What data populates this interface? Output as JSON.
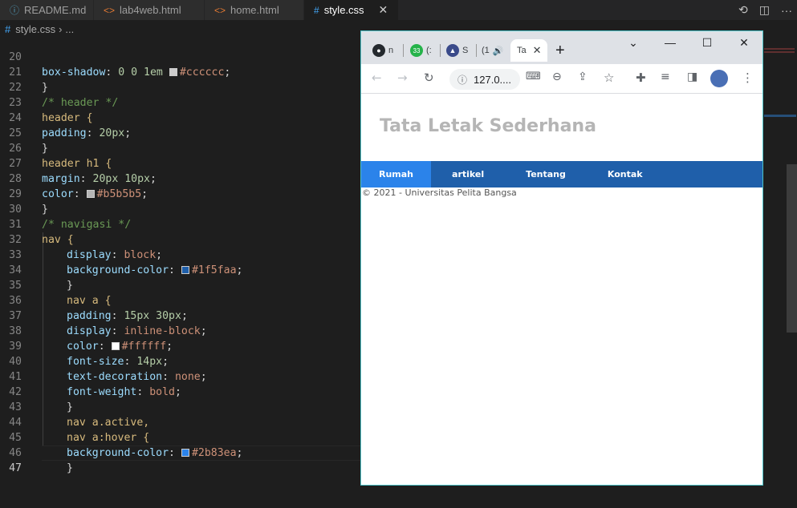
{
  "editor_tabs": [
    {
      "label": "README.md",
      "icon": "info-icon"
    },
    {
      "label": "lab4web.html",
      "icon": "html-icon"
    },
    {
      "label": "home.html",
      "icon": "html-icon"
    },
    {
      "label": "style.css",
      "icon": "css-icon",
      "active": true
    }
  ],
  "breadcrumb": {
    "file": "style.css",
    "rest": "..."
  },
  "code_lines": [
    {
      "n": "20",
      "t": "box-shadow: 0 0 1em #cccccc;"
    },
    {
      "n": "21",
      "t": "}"
    },
    {
      "n": "22",
      "t": "/* header */"
    },
    {
      "n": "23",
      "t": "header {"
    },
    {
      "n": "24",
      "t": "padding: 20px;"
    },
    {
      "n": "25",
      "t": "}"
    },
    {
      "n": "26",
      "t": "header h1 {"
    },
    {
      "n": "27",
      "t": "margin: 20px 10px;"
    },
    {
      "n": "28",
      "t": "color: #b5b5b5;"
    },
    {
      "n": "29",
      "t": "}"
    },
    {
      "n": "30",
      "t": "/* navigasi */"
    },
    {
      "n": "31",
      "t": "nav {"
    },
    {
      "n": "32",
      "t": "display: block;"
    },
    {
      "n": "33",
      "t": "background-color: #1f5faa;"
    },
    {
      "n": "34",
      "t": "}"
    },
    {
      "n": "35",
      "t": "nav a {"
    },
    {
      "n": "36",
      "t": "padding: 15px 30px;"
    },
    {
      "n": "37",
      "t": "display: inline-block;"
    },
    {
      "n": "38",
      "t": "color: #ffffff;"
    },
    {
      "n": "39",
      "t": "font-size: 14px;"
    },
    {
      "n": "40",
      "t": "text-decoration: none;"
    },
    {
      "n": "41",
      "t": "font-weight: bold;"
    },
    {
      "n": "42",
      "t": "}"
    },
    {
      "n": "43",
      "t": "nav a.active,"
    },
    {
      "n": "44",
      "t": "nav a:hover {"
    },
    {
      "n": "45",
      "t": "background-color: #2b83ea;"
    },
    {
      "n": "46",
      "t": "}"
    },
    {
      "n": "47",
      "t": ""
    }
  ],
  "browser": {
    "tabs": [
      "n",
      "(:",
      "S",
      "(1",
      "Ta"
    ],
    "tab_badge": "33",
    "address": "127.0....",
    "page": {
      "title": "Tata Letak Sederhana",
      "nav": [
        "Rumah",
        "artikel",
        "Tentang",
        "Kontak"
      ],
      "footer": "© 2021 - Universitas Pelita Bangsa"
    }
  },
  "colors": {
    "nav_bg": "#1f5faa",
    "nav_active": "#2b83ea",
    "title": "#b5b5b5",
    "swatch_cccccc": "#cccccc",
    "swatch_b5b5b5": "#b5b5b5",
    "swatch_1f5faa": "#1f5faa",
    "swatch_ffffff": "#ffffff",
    "swatch_2b83ea": "#2b83ea"
  }
}
